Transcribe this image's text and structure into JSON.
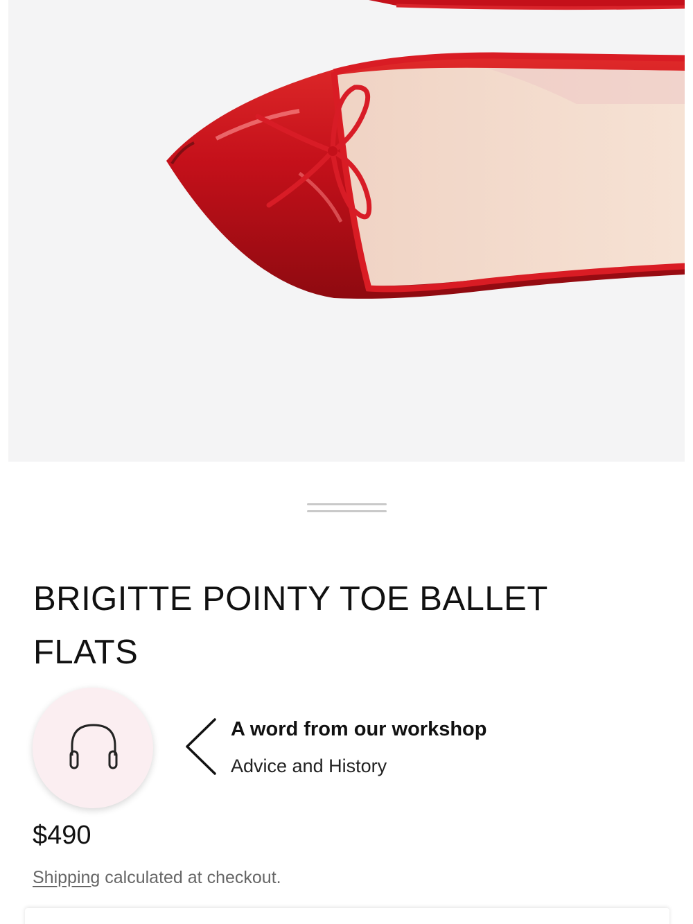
{
  "product": {
    "image_icon": "red-ballet-flat-image",
    "title_line1": "BRIGITTE POINTY TOE BALLET",
    "title_line2": "FLATS",
    "price": "$490"
  },
  "audio_guide": {
    "icon": "headphones-icon",
    "title": "A word from our workshop",
    "subtitle": "Advice and History"
  },
  "shipping": {
    "link_text": "Shipping",
    "rest_text": " calculated at checkout."
  },
  "colors": {
    "shoe_red": "#c4101a",
    "lining_beige": "#f3dccb",
    "audio_bg": "#fbeef1",
    "image_bg": "#f4f4f5"
  }
}
